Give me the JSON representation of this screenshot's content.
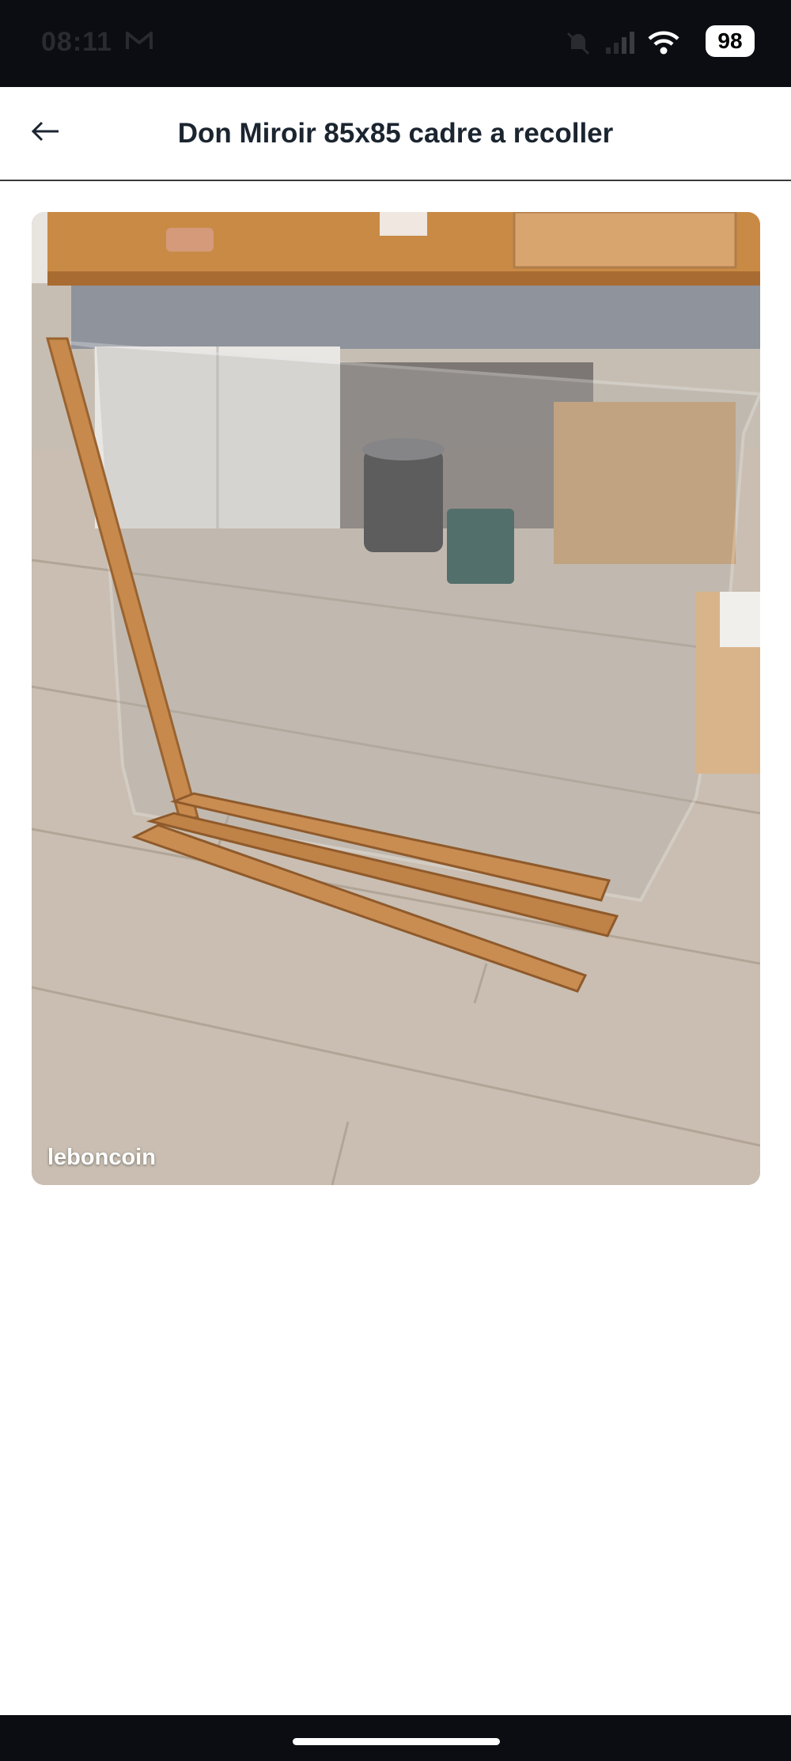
{
  "status_bar": {
    "time": "08:11",
    "battery": "98",
    "icons": [
      "mail-icon",
      "mute-icon",
      "signal-icon",
      "wifi-icon",
      "battery-icon"
    ]
  },
  "header": {
    "back_icon": "arrow-left-icon",
    "title": "Don Miroir 85x85 cadre a recoller"
  },
  "photo": {
    "watermark": "leboncoin"
  },
  "colors": {
    "status_bar_bg": "#0c0d12",
    "title_text": "#1b2530",
    "background": "#ffffff"
  }
}
